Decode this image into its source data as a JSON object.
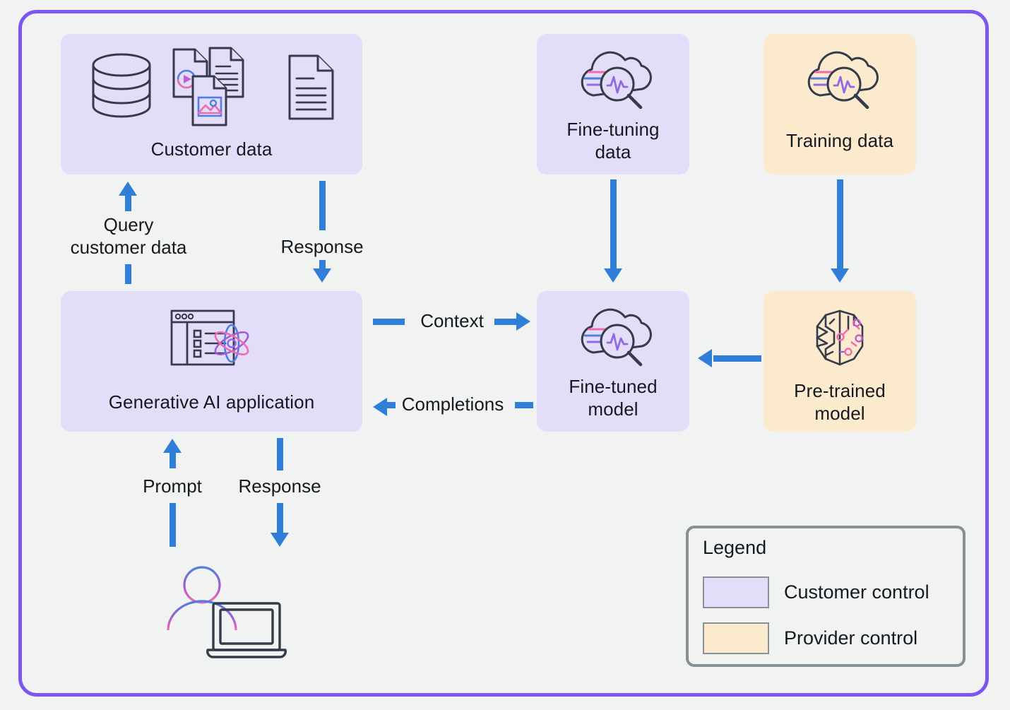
{
  "diagram": {
    "frame_color": "#7d55f0",
    "background": "#f1f2f2",
    "arrow_color": "#2f7ed8",
    "customer_fill": "#e4ddfa",
    "provider_fill": "#fceace"
  },
  "nodes": {
    "customer_data": {
      "label": "Customer data",
      "control": "customer",
      "icons": [
        "database-icon",
        "multi-document-icon",
        "document-icon"
      ]
    },
    "finetuning_data": {
      "label": "Fine-tuning\ndata",
      "control": "customer",
      "icons": [
        "cloud-analytics-icon"
      ]
    },
    "training_data": {
      "label": "Training data",
      "control": "provider",
      "icons": [
        "cloud-analytics-icon"
      ]
    },
    "genai_app": {
      "label": "Generative AI application",
      "control": "customer",
      "icons": [
        "app-window-atom-icon"
      ]
    },
    "finetuned_model": {
      "label": "Fine-tuned\nmodel",
      "control": "customer",
      "icons": [
        "cloud-analytics-icon"
      ]
    },
    "pretrained_model": {
      "label": "Pre-trained\nmodel",
      "control": "provider",
      "icons": [
        "brain-circuit-icon"
      ]
    }
  },
  "edges": {
    "query_customer_data": "Query\ncustomer data",
    "response_top": "Response",
    "context": "Context",
    "completions": "Completions",
    "prompt": "Prompt",
    "response_bottom": "Response"
  },
  "actor": {
    "name": "user-with-laptop"
  },
  "legend": {
    "title": "Legend",
    "items": [
      {
        "label": "Customer control",
        "color": "#e4ddfa"
      },
      {
        "label": "Provider control",
        "color": "#fceace"
      }
    ]
  }
}
